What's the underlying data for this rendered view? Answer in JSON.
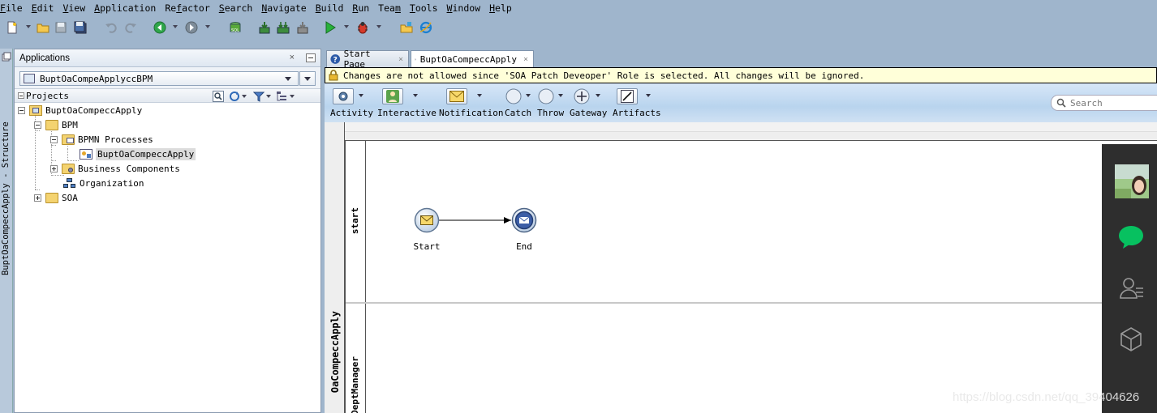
{
  "menu": [
    "File",
    "Edit",
    "View",
    "Application",
    "Refactor",
    "Search",
    "Navigate",
    "Build",
    "Run",
    "Team",
    "Tools",
    "Window",
    "Help"
  ],
  "menu_mnemonics": [
    "F",
    "E",
    "V",
    "A",
    "f",
    "S",
    "N",
    "B",
    "R",
    "m",
    "T",
    "W",
    "H"
  ],
  "left_strip": {
    "label": "BuptOaCompeccApply - Structure"
  },
  "apps_panel": {
    "title": "Applications",
    "selected_app": "BuptOaCompeApplyccBPM",
    "projects_label": "Projects",
    "tree": [
      {
        "label": "BuptOaCompeccApply"
      },
      {
        "label": "BPM"
      },
      {
        "label": "BPMN Processes"
      },
      {
        "label": "BuptOaCompeccApply"
      },
      {
        "label": "Business Components"
      },
      {
        "label": "Organization"
      },
      {
        "label": "SOA"
      }
    ]
  },
  "tabs": [
    {
      "label": "Start Page"
    },
    {
      "label": "BuptOaCompeccApply"
    }
  ],
  "warning": "Changes are not allowed since 'SOA Patch Deveoper' Role is selected. All changes will be ignored.",
  "palette": {
    "items": [
      "Activity",
      "Interactive",
      "Notification",
      "Catch",
      "Throw",
      "Gateway",
      "Artifacts"
    ],
    "search_placeholder": "Search"
  },
  "diagram": {
    "lanes": [
      "start",
      "DeptManager"
    ],
    "pool_label": "OaCompeccApply",
    "events": [
      {
        "label": "Start"
      },
      {
        "label": "End"
      }
    ]
  },
  "watermark": "https://blog.csdn.net/qq_39404626",
  "colors": {
    "accent": "#3c5ea6",
    "warning_bg": "#ffffd9",
    "chat_green": "#07c160",
    "side_panel": "#2e2e2e"
  }
}
